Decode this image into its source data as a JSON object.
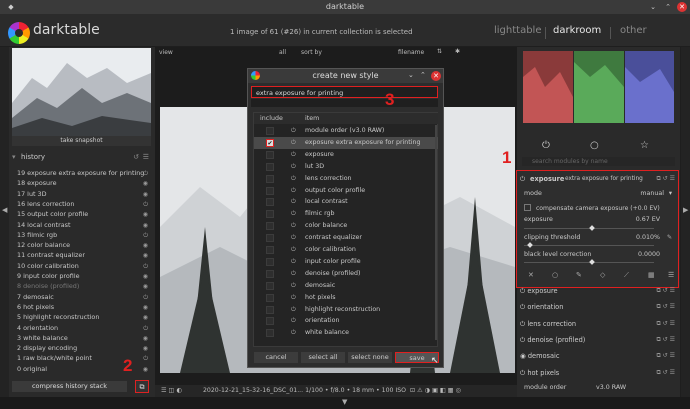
{
  "window": {
    "title": "darktable"
  },
  "app": {
    "brand": "darktable",
    "version": "",
    "collection_msg": "1 image of 61 (#26) in current collection is selected"
  },
  "views": {
    "lighttable": "lighttable",
    "darkroom": "darkroom",
    "other": "other"
  },
  "left": {
    "snapshot_btn": "take snapshot",
    "history_title": "history",
    "history_items": [
      "19 exposure extra exposure for printing",
      "18 exposure",
      "17 lut 3D",
      "16 lens correction",
      "15 output color profile",
      "14 local contrast",
      "13 filmic rgb",
      "12 color balance",
      "11 contrast equalizer",
      "10 color calibration",
      "9 input color profile",
      "8 denoise (profiled)",
      "7 demosaic",
      "6 hot pixels",
      "5 highlight reconstruction",
      "4 orientation",
      "3 white balance",
      "2 display encoding",
      "1 raw black/white point",
      "0 original"
    ],
    "compress_btn": "compress history stack"
  },
  "viewbar": {
    "view": "view",
    "all": "all",
    "sort_by": "sort by",
    "filename": "filename"
  },
  "dialog": {
    "title": "create new style",
    "name_value": "extra exposure for printing",
    "col_include": "include",
    "col_item": "item",
    "items": [
      "module order (v3.0 RAW)",
      "exposure extra exposure for printing",
      "exposure",
      "lut 3D",
      "lens correction",
      "output color profile",
      "local contrast",
      "filmic rgb",
      "color balance",
      "contrast equalizer",
      "color calibration",
      "input color profile",
      "denoise (profiled)",
      "demosaic",
      "hot pixels",
      "highlight reconstruction",
      "orientation",
      "white balance"
    ],
    "cancel": "cancel",
    "select_all": "select all",
    "select_none": "select none",
    "save": "save"
  },
  "right": {
    "search_placeholder": "search modules by name",
    "exposure_title": "exposure",
    "exposure_sub": "extra exposure for printing",
    "mode_label": "mode",
    "mode_value": "manual",
    "compensate": "compensate camera exposure (+0.0 EV)",
    "exposure_label": "exposure",
    "exposure_value": "0.67 EV",
    "clipping_label": "clipping threshold",
    "clipping_value": "0.010%",
    "black_label": "black level correction",
    "black_value": "0.0000",
    "modules": [
      "exposure",
      "orientation",
      "lens correction",
      "denoise (profiled)",
      "demosaic",
      "hot pixels"
    ],
    "module_order_label": "module order",
    "module_order_value": "v3.0 RAW"
  },
  "filmstrip": {
    "text": "2020-12-21_15-32-16_DSC_01...   1/100 • f/8.0 • 18 mm • 100 ISO"
  },
  "annotations": {
    "n1": "1",
    "n2": "2",
    "n3": "3"
  },
  "colors": {
    "accent_red": "#e02020",
    "bg": "#2a2a2a"
  }
}
